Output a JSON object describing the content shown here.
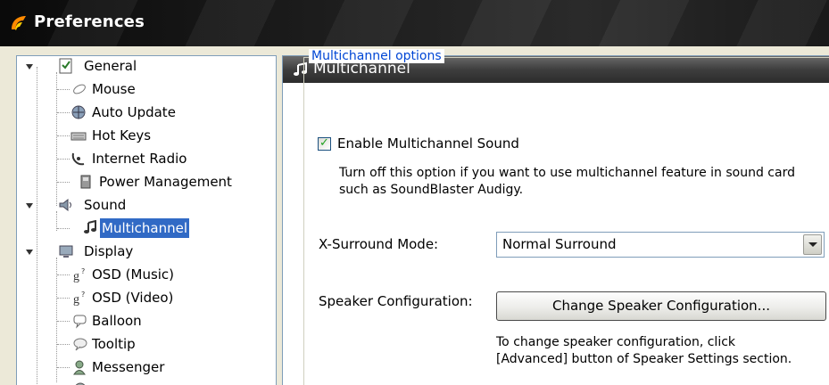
{
  "window": {
    "title": "Preferences"
  },
  "tree": {
    "items": [
      {
        "label": "General",
        "icon": "checklist-icon"
      },
      {
        "label": "Mouse",
        "icon": "mouse-icon"
      },
      {
        "label": "Auto Update",
        "icon": "globe-update-icon"
      },
      {
        "label": "Hot Keys",
        "icon": "keyboard-icon"
      },
      {
        "label": "Internet Radio",
        "icon": "satellite-dish-icon"
      },
      {
        "label": "Power Management",
        "icon": "power-icon"
      },
      {
        "label": "Sound",
        "icon": "speaker-icon"
      },
      {
        "label": "Multichannel",
        "icon": "music-note-icon",
        "selected": true
      },
      {
        "label": "Display",
        "icon": "monitor-icon"
      },
      {
        "label": "OSD (Music)",
        "icon": "osd-icon"
      },
      {
        "label": "OSD (Video)",
        "icon": "osd-icon"
      },
      {
        "label": "Balloon",
        "icon": "balloon-icon"
      },
      {
        "label": "Tooltip",
        "icon": "tooltip-icon"
      },
      {
        "label": "Messenger",
        "icon": "messenger-icon"
      }
    ]
  },
  "panel": {
    "title": "Multichannel",
    "group_label": "Multichannel options",
    "enable_label": "Enable Multichannel Sound",
    "enable_checked": true,
    "enable_desc_line1": "Turn off this option if you want to use multichannel feature in sound card",
    "enable_desc_line2": "such as SoundBlaster Audigy.",
    "surround_label": "X-Surround Mode:",
    "surround_value": "Normal Surround",
    "speaker_label": "Speaker Configuration:",
    "speaker_button": "Change Speaker Configuration...",
    "speaker_note_line1": "To change speaker configuration, click",
    "speaker_note_line2": "[Advanced] button of Speaker Settings section."
  },
  "colors": {
    "selection": "#316ac5",
    "group_label": "#0046d5"
  }
}
